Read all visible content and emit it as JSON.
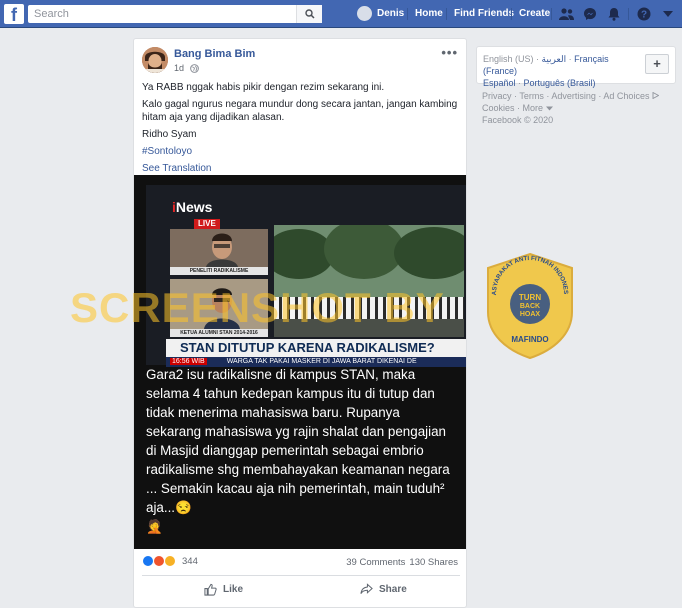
{
  "topbar": {
    "logo": "f",
    "search_placeholder": "Search",
    "user_name": "Denis",
    "home": "Home",
    "find_friends": "Find Friends",
    "create": "Create",
    "icons": [
      "friends-icon",
      "messenger-icon",
      "notifications-icon",
      "help-icon",
      "dropdown-icon"
    ]
  },
  "post": {
    "author": "Bang Bima Bim",
    "time": "1d",
    "privacy_icon": "globe-icon",
    "more": "•••",
    "lines": [
      "Ya RABB nggak habis pikir dengan rezim sekarang ini.",
      "Kalo gagal ngurus negara mundur dong secara jantan, jangan kambing hitam aja yang dijadikan alasan.",
      "Ridho Syam"
    ],
    "hashtag": "#Sontoloyo",
    "see_translation": "See Translation",
    "image": {
      "channel": "News",
      "live": "LIVE",
      "label1": "PENELITI RADIKALISME",
      "label2": "KETUA ALUMNI STAN 2014-2016",
      "headline": "STAN DITUTUP KARENA RADIKALISME?",
      "ticker_time": "16:56 WIB",
      "ticker": "WARGA TAK PAKAI MASKER DI JAWA BARAT DIKENAI DE",
      "caption": "Gara2 isu radikalisne di kampus STAN, maka selama 4 tahun kedepan kampus itu di tutup dan tidak menerima mahasiswa baru. Rupanya sekarang  mahasiswa yg rajin shalat dan pengajian di Masjid dianggap pemerintah sebagai embrio radikalisme shg membahayakan keamanan negara ... Semakin kacau aja nih pemerintah, main tuduh² aja...😒",
      "caption_emoji": "🤦"
    },
    "reactions_count": "344",
    "comments": "39 Comments",
    "shares": "130 Shares",
    "like_label": "Like",
    "share_label": "Share"
  },
  "watermark": {
    "text": "SCREENSHOT BY",
    "seal_top": "MASYARAKAT ANTI FITNAH INDONESIA",
    "seal_center_1": "TURN",
    "seal_center_2": "BACK",
    "seal_center_3": "HOAX",
    "seal_bottom": "MAFINDO"
  },
  "sidebar": {
    "languages": [
      "English (US)",
      "العربية",
      "Français (France)",
      "Español",
      "Português (Brasil)"
    ],
    "add_language": "+",
    "footer_links": [
      "Privacy",
      "Terms",
      "Advertising",
      "Ad Choices",
      "Cookies",
      "More"
    ],
    "copyright": "Facebook © 2020"
  },
  "colors": {
    "brand": "#4267b2",
    "link": "#365899",
    "background": "#e9ebee",
    "watermark": "#ffc428"
  }
}
